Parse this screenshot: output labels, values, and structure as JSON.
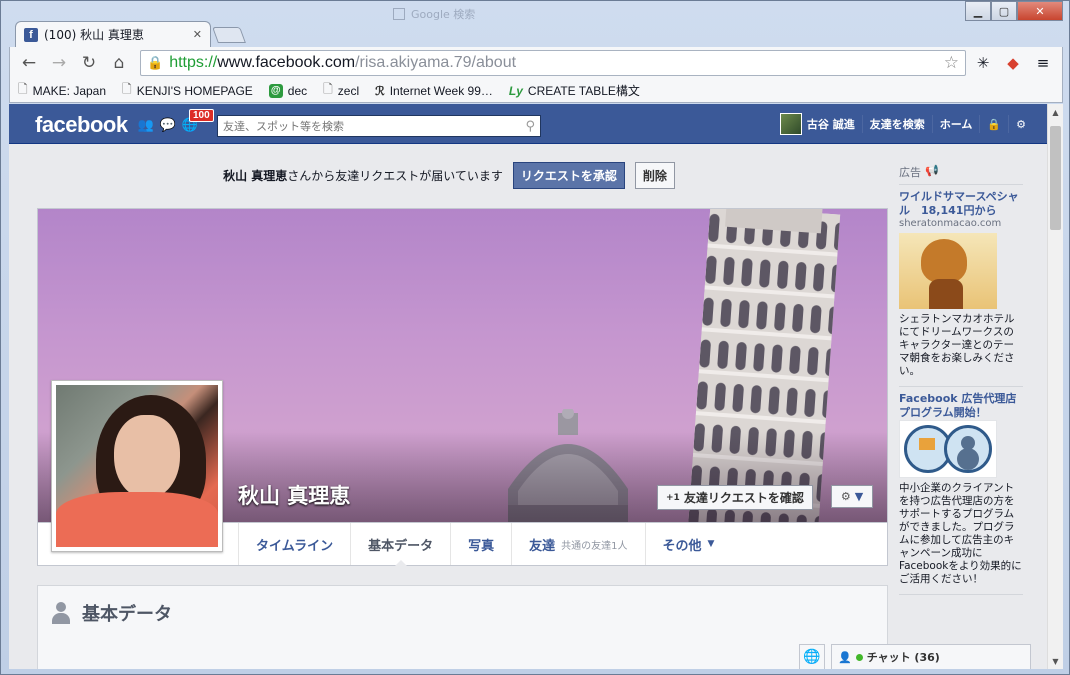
{
  "browser": {
    "tab_title": "(100) 秋山 真理恵",
    "tab_close": "✕",
    "bg_tab_title": "Google 検索",
    "window_buttons": {
      "minimize": "▁",
      "maximize": "▢",
      "close": "✕"
    },
    "url": {
      "scheme": "https://",
      "host": "www.facebook.com",
      "path": "/risa.akiyama.79/about"
    },
    "bookmarks": [
      {
        "label": "MAKE: Japan",
        "icon": "page-icon"
      },
      {
        "label": "KENJI'S HOMEPAGE",
        "icon": "page-icon"
      },
      {
        "label": "dec",
        "icon": "at-icon"
      },
      {
        "label": "zecl",
        "icon": "page-icon"
      },
      {
        "label": "Internet Week 99…",
        "icon": "site-icon"
      },
      {
        "label": "CREATE TABLE構文",
        "icon": "ly-icon"
      }
    ]
  },
  "facebook": {
    "logo": "facebook",
    "notifications_count": "100",
    "search_placeholder": "友達、スポット等を検索",
    "nav": {
      "user": "古谷 誠進",
      "find_friends": "友達を検索",
      "home": "ホーム"
    },
    "friend_request": {
      "name": "秋山 真理恵",
      "message": "さんから友達リクエストが届いています",
      "confirm": "リクエストを承認",
      "delete": "削除"
    },
    "profile": {
      "name": "秋山 真理恵",
      "confirm_request_button": "友達リクエストを確認",
      "confirm_request_prefix": "+1"
    },
    "tabs": [
      {
        "label": "タイムライン"
      },
      {
        "label": "基本データ",
        "active": true
      },
      {
        "label": "写真"
      },
      {
        "label": "友達",
        "sub": "共通の友達1人"
      },
      {
        "label": "その他",
        "caret": "▼"
      }
    ],
    "about_title": "基本データ",
    "ads": {
      "header": "広告",
      "items": [
        {
          "title": "ワイルドサマースペシャル　18,141円から",
          "domain": "sheratonmacao.com",
          "body": "シェラトンマカオホテルにてドリームワークスのキャラクター達とのテーマ朝食をお楽しみください。"
        },
        {
          "title": "Facebook 広告代理店プログラム開始！",
          "domain": "",
          "body": "中小企業のクライアントを持つ広告代理店の方をサポートするプログラムができました。プログラムに参加して広告主のキャンペーン成功にFacebookをより効果的にご活用ください！"
        }
      ]
    },
    "chat": {
      "label": "チャット (36)"
    }
  },
  "colors": {
    "fb_blue": "#3b5998",
    "cover_sky": "#c596cf",
    "ssl_green": "#1e9d34"
  }
}
